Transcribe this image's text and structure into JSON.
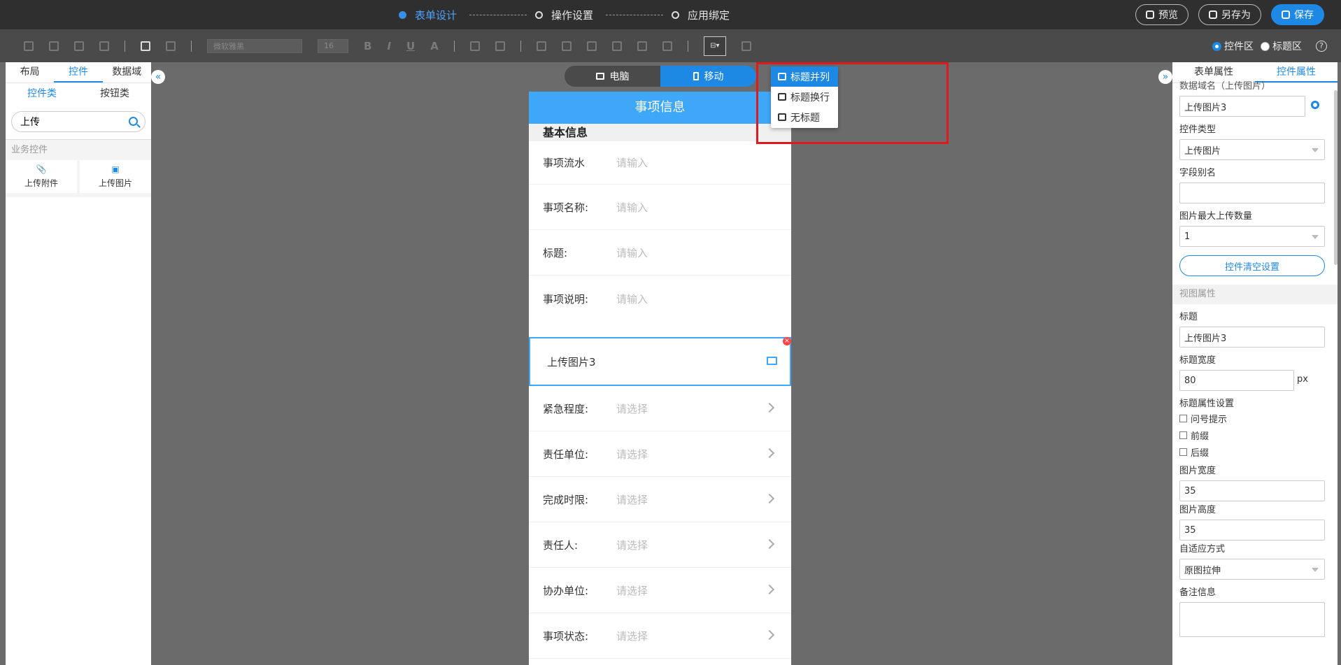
{
  "steps": [
    {
      "label": "表单设计",
      "active": true
    },
    {
      "label": "操作设置",
      "active": false
    },
    {
      "label": "应用绑定",
      "active": false
    }
  ],
  "top_buttons": {
    "preview": "预览",
    "save_as": "另存为",
    "save": "保存"
  },
  "toolbar": {
    "font_family": "微软雅黑",
    "font_size": "16",
    "bold": "B",
    "italic": "I",
    "underline": "U",
    "font_color": "A",
    "layout_btn": "⊟▾"
  },
  "zone_radios": {
    "control_zone": "控件区",
    "title_zone": "标题区",
    "help": "?"
  },
  "left_panel": {
    "tabs": [
      "布局",
      "控件",
      "数据域"
    ],
    "subtabs": [
      "控件类",
      "按钮类"
    ],
    "search_value": "上传",
    "section": "业务控件",
    "components": [
      {
        "icon": "📎",
        "label": "上传附件"
      },
      {
        "icon": "▣",
        "label": "上传图片"
      }
    ]
  },
  "collapse": {
    "left": "«",
    "right": "»"
  },
  "device": {
    "pc": "电脑",
    "mobile": "移动"
  },
  "form": {
    "header": "事项信息",
    "section": "基本信息",
    "rows_input": [
      {
        "label": "事项流水",
        "placeholder": "请输入"
      },
      {
        "label": "事项名称:",
        "placeholder": "请输入"
      },
      {
        "label": "标题:",
        "placeholder": "请输入"
      }
    ],
    "row_desc": {
      "label": "事项说明:",
      "placeholder": "请输入"
    },
    "selected": {
      "label": "上传图片3"
    },
    "rows_select": [
      {
        "label": "紧急程度:",
        "placeholder": "请选择"
      },
      {
        "label": "责任单位:",
        "placeholder": "请选择"
      },
      {
        "label": "完成时限:",
        "placeholder": "请选择"
      },
      {
        "label": "责任人:",
        "placeholder": "请选择"
      },
      {
        "label": "协办单位:",
        "placeholder": "请选择"
      },
      {
        "label": "事项状态:",
        "placeholder": "请选择"
      }
    ]
  },
  "dropdown": {
    "items": [
      "标题并列",
      "标题换行",
      "无标题"
    ],
    "selected_index": 0
  },
  "right_panel": {
    "tabs": [
      "表单属性",
      "控件属性"
    ],
    "datafield_label": "数据域名（上传图片）",
    "datafield_value": "上传图片3",
    "control_type_label": "控件类型",
    "control_type_value": "上传图片",
    "alias_label": "字段别名",
    "alias_value": "",
    "max_upload_label": "图片最大上传数量",
    "max_upload_value": "1",
    "clear_btn": "控件清空设置",
    "view_section": "视图属性",
    "title_label": "标题",
    "title_value": "上传图片3",
    "title_width_label": "标题宽度",
    "title_width_value": "80",
    "title_width_unit": "px",
    "title_attr_label": "标题属性设置",
    "checks": [
      "问号提示",
      "前缀",
      "后缀"
    ],
    "img_width_label": "图片宽度",
    "img_width_value": "35",
    "img_height_label": "图片高度",
    "img_height_value": "35",
    "fit_label": "自适应方式",
    "fit_value": "原图拉伸",
    "remark_label": "备注信息"
  },
  "colors": {
    "accent": "#1e88e5",
    "header_blue": "#3ea7f8",
    "highlight": "#e0191f"
  }
}
